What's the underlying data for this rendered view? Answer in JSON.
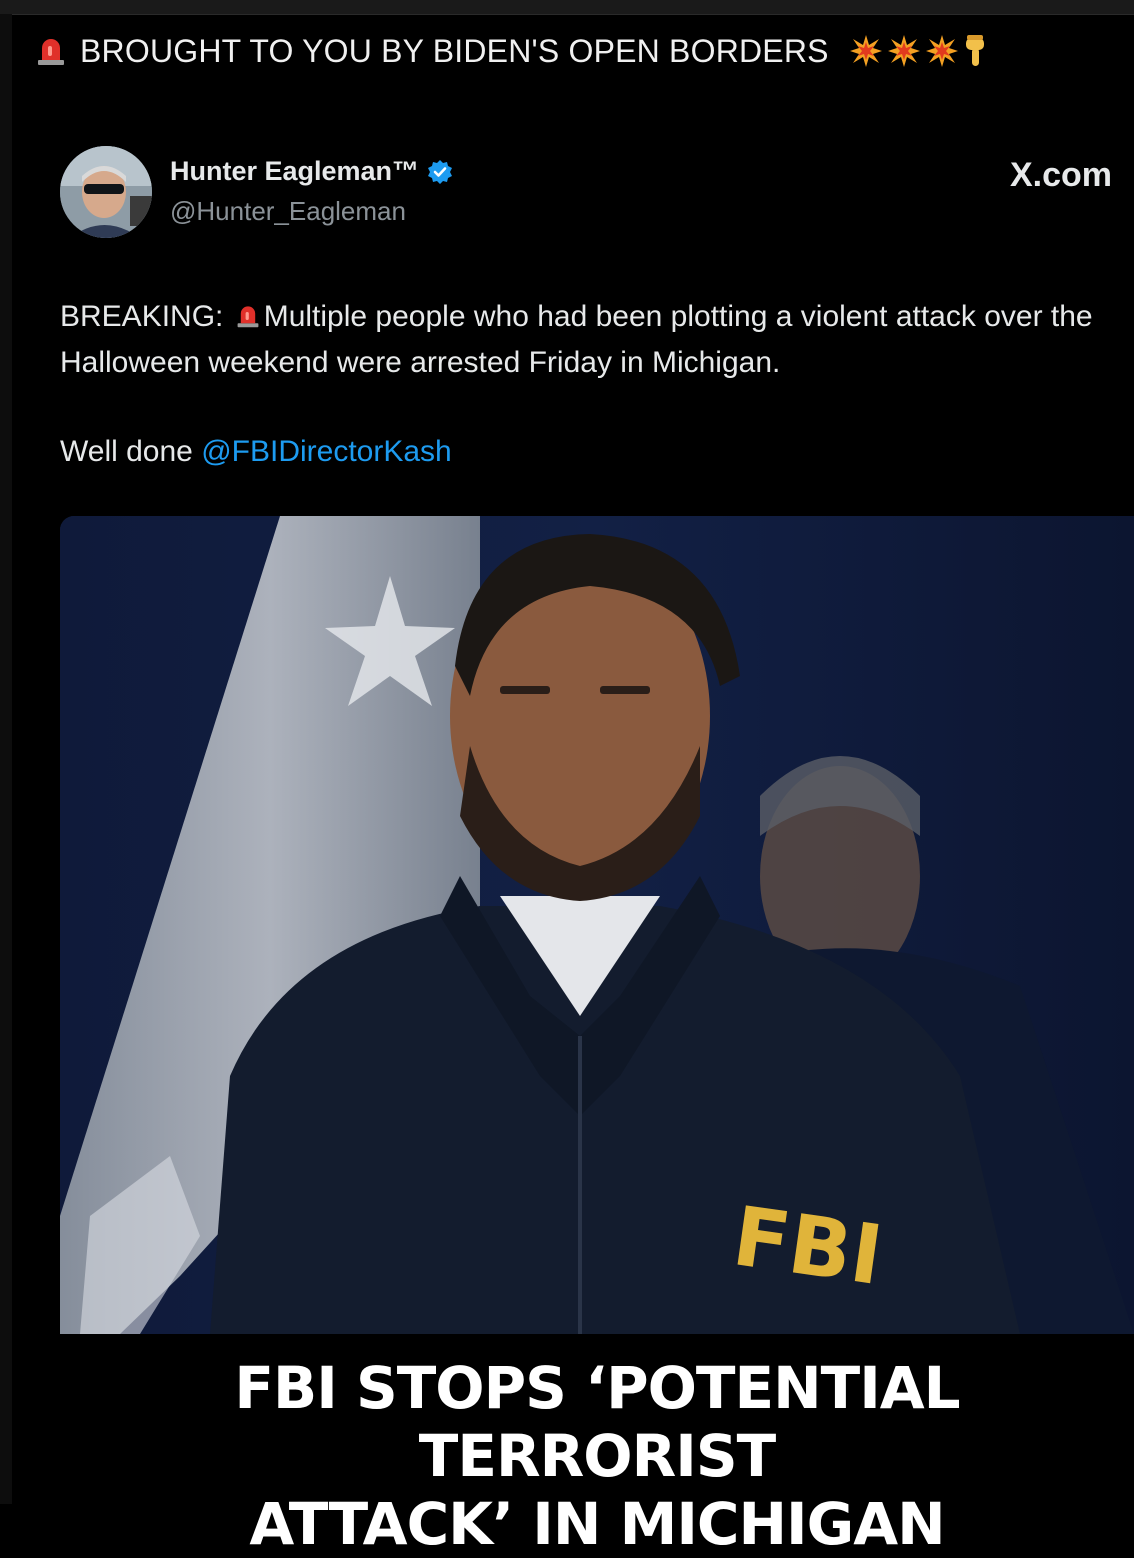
{
  "banner": {
    "text": "BROUGHT TO YOU BY BIDEN'S OPEN BORDERS",
    "leading_icon": "siren-icon",
    "trailing_icons": [
      "explosion-icon",
      "explosion-icon",
      "explosion-icon",
      "point-down-icon"
    ]
  },
  "post": {
    "author_name": "Hunter Eagleman™",
    "handle": "@Hunter_Eagleman",
    "verified": true,
    "source": "X.com",
    "body_prefix": "BREAKING:",
    "body_text": "Multiple people who had been plotting a violent attack over the Halloween weekend were arrested Friday in Michigan.",
    "well_done": "Well done",
    "mention": "@FBIDirectorKash"
  },
  "media": {
    "jacket_text": "FBI",
    "headline_line1": "FBI STOPS ‘POTENTIAL TERRORIST",
    "headline_line2": "ATTACK’ IN MICHIGAN"
  },
  "colors": {
    "background": "#000000",
    "text": "#e7e9ea",
    "secondary": "#8b9298",
    "link": "#1d9bf0",
    "verified": "#1d9bf0",
    "fbi_yellow": "#e0b43a"
  }
}
